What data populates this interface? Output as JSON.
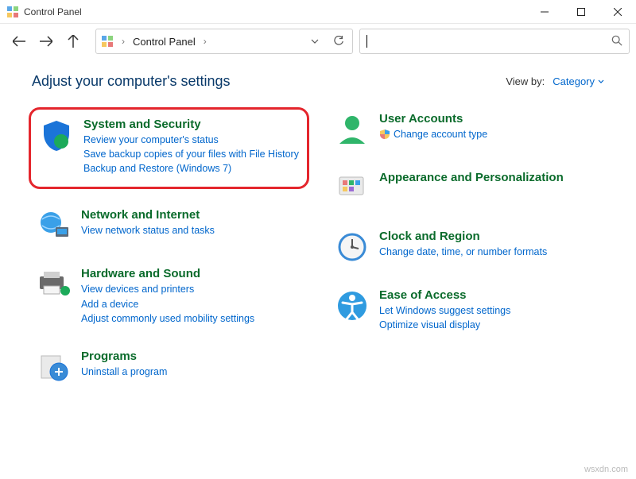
{
  "window": {
    "title": "Control Panel"
  },
  "address": {
    "location": "Control Panel"
  },
  "search": {
    "placeholder": ""
  },
  "header": {
    "heading": "Adjust your computer's settings",
    "viewby_label": "View by:",
    "viewby_value": "Category"
  },
  "categories": {
    "left": [
      {
        "id": "system-security",
        "title": "System and Security",
        "links": [
          "Review your computer's status",
          "Save backup copies of your files with File History",
          "Backup and Restore (Windows 7)"
        ],
        "highlighted": true
      },
      {
        "id": "network-internet",
        "title": "Network and Internet",
        "links": [
          "View network status and tasks"
        ]
      },
      {
        "id": "hardware-sound",
        "title": "Hardware and Sound",
        "links": [
          "View devices and printers",
          "Add a device",
          "Adjust commonly used mobility settings"
        ]
      },
      {
        "id": "programs",
        "title": "Programs",
        "links": [
          "Uninstall a program"
        ]
      }
    ],
    "right": [
      {
        "id": "user-accounts",
        "title": "User Accounts",
        "links": [
          "Change account type"
        ],
        "shield": true
      },
      {
        "id": "appearance",
        "title": "Appearance and Personalization",
        "links": []
      },
      {
        "id": "clock-region",
        "title": "Clock and Region",
        "links": [
          "Change date, time, or number formats"
        ]
      },
      {
        "id": "ease-of-access",
        "title": "Ease of Access",
        "links": [
          "Let Windows suggest settings",
          "Optimize visual display"
        ]
      }
    ]
  },
  "watermark": "wsxdn.com"
}
